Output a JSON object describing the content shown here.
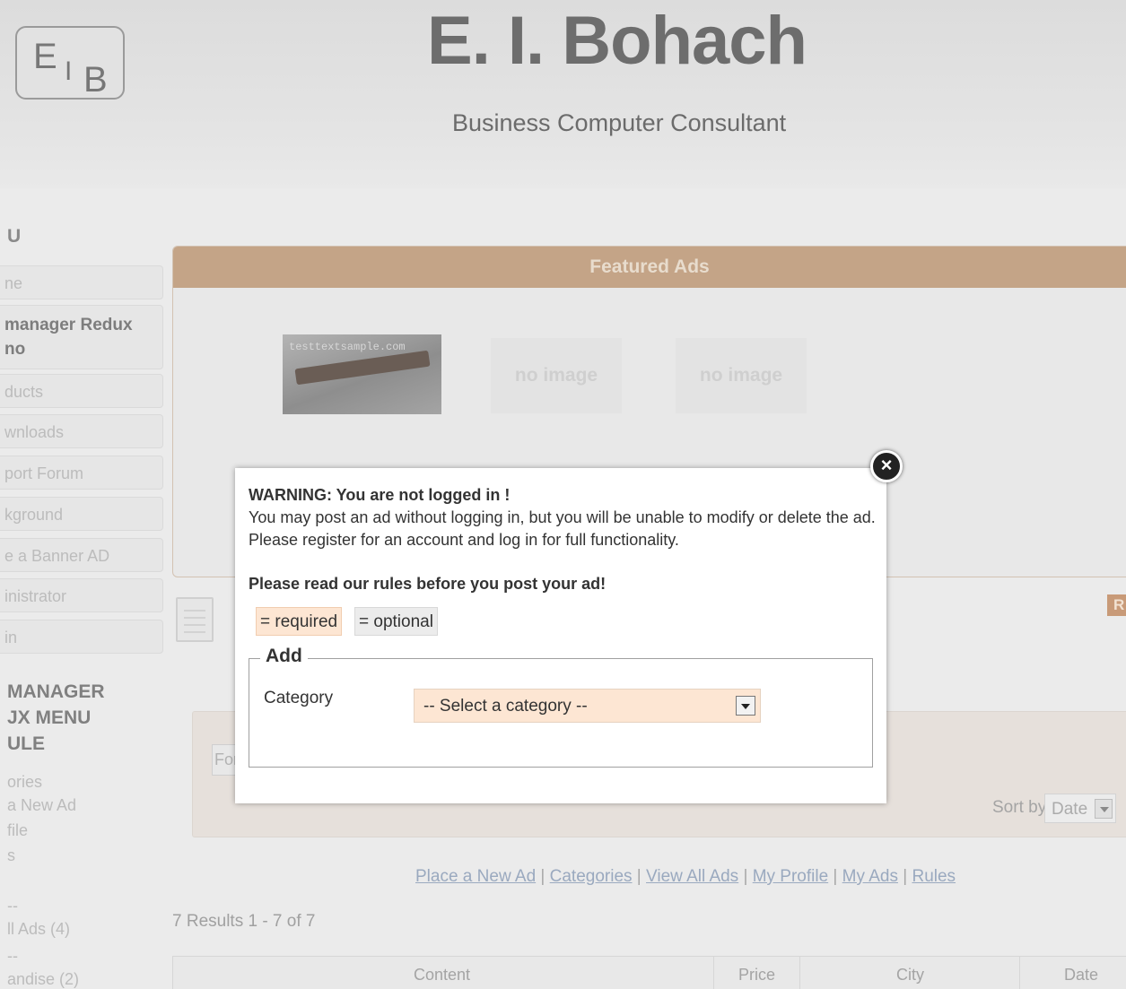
{
  "header": {
    "logo_e": "E",
    "logo_i": "I",
    "logo_b": "B",
    "title": "E. I. Bohach",
    "subtitle": "Business Computer Consultant"
  },
  "sidebar": {
    "heading": "U",
    "items": [
      {
        "label": "ne"
      },
      {
        "label": "manager Redux",
        "label2": "no"
      },
      {
        "label": "ducts"
      },
      {
        "label": "wnloads"
      },
      {
        "label": "port Forum"
      },
      {
        "label": "kground"
      },
      {
        "label": "e a Banner AD"
      },
      {
        "label": "inistrator"
      },
      {
        "label": "in"
      }
    ],
    "module_title_1": "MANAGER",
    "module_title_2": "JX MENU",
    "module_title_3": "ULE",
    "links": [
      "ories",
      "a New Ad",
      "file",
      "s",
      "--",
      "ll Ads (4)",
      "--",
      "andise (2)"
    ]
  },
  "featured": {
    "heading": "Featured Ads",
    "thumb_watermark": "testtextsample.com",
    "no_image_1": "no image",
    "no_image_2": "no image"
  },
  "filter": {
    "input_value": "For",
    "sort_label": "Sort by",
    "sort_value": "Date"
  },
  "r_badge": "R",
  "bottom_links": {
    "place": "Place a New Ad",
    "categories": "Categories",
    "view_all": "View All Ads",
    "profile": "My Profile",
    "my_ads": "My Ads",
    "rules": "Rules",
    "separator": " | "
  },
  "results": "7 Results 1 - 7 of 7",
  "table": {
    "col_content": "Content",
    "col_price": "Price",
    "col_city": "City",
    "col_date": "Date"
  },
  "modal": {
    "close_glyph": "×",
    "warning": "WARNING: You are not logged in !",
    "line1": "You may post an ad without logging in, but you will be unable to modify or delete the ad.",
    "line2": "Please register for an account and log in for full functionality.",
    "rules_note": "Please read our rules before you post your ad!",
    "legend_required": "= required",
    "legend_optional": "= optional",
    "fieldset_title": "Add",
    "category_label": "Category",
    "category_select": "-- Select a category --"
  },
  "colors": {
    "accent": "#c4a487",
    "required_bg": "#fde6d3",
    "link": "#9aa9bf"
  }
}
